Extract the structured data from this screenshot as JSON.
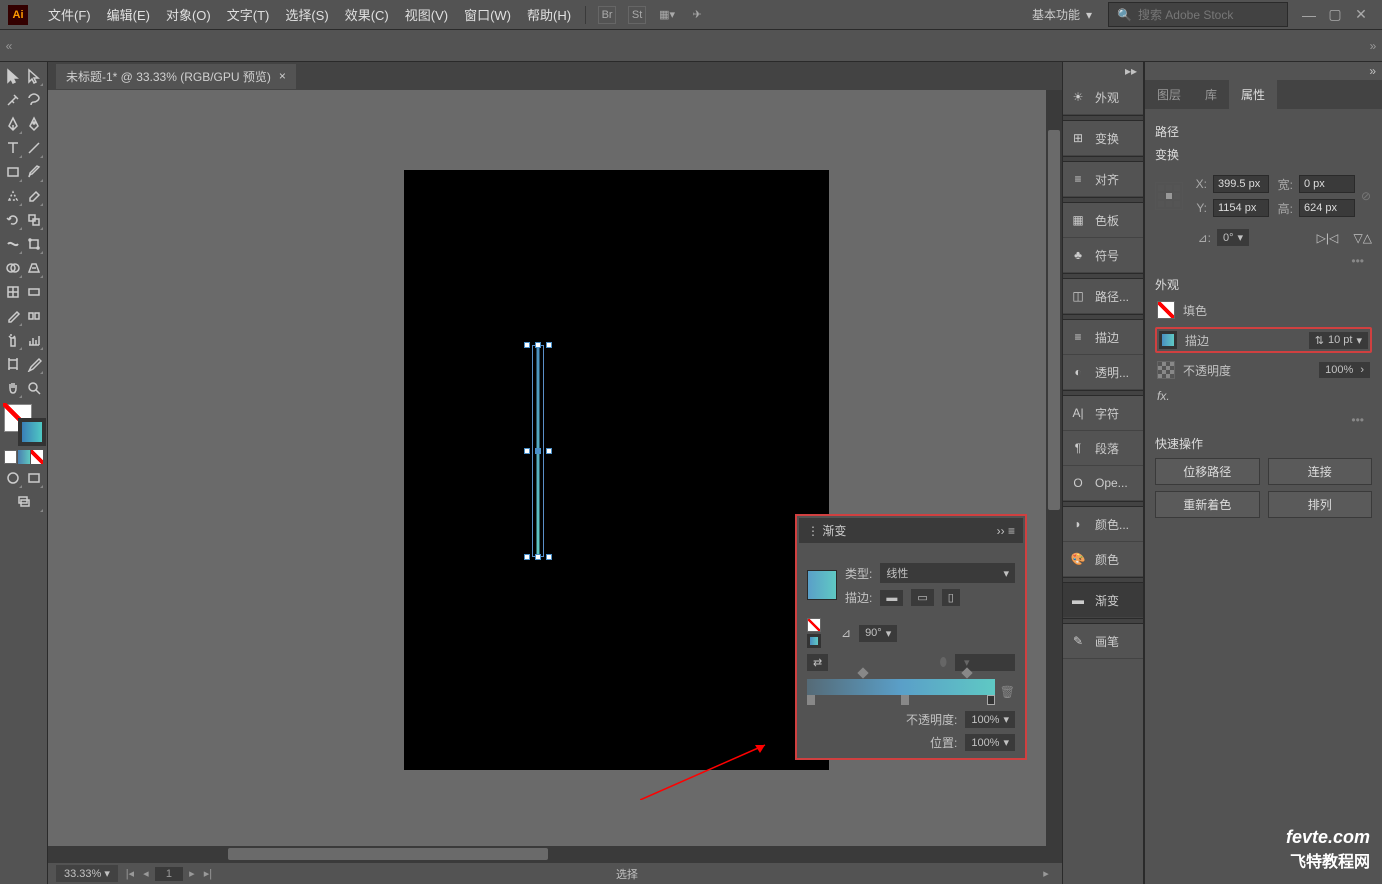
{
  "menubar": [
    "文件(F)",
    "编辑(E)",
    "对象(O)",
    "文字(T)",
    "选择(S)",
    "效果(C)",
    "视图(V)",
    "窗口(W)",
    "帮助(H)"
  ],
  "top_icons": [
    "Br",
    "St"
  ],
  "workspace": "基本功能",
  "search_placeholder": "搜索 Adobe Stock",
  "doc_tab": "未标题-1* @ 33.33% (RGB/GPU 预览)",
  "status": {
    "zoom": "33.33%",
    "mode": "选择"
  },
  "dock": [
    "外观",
    "变换",
    "对齐",
    "色板",
    "符号",
    "路径...",
    "描边",
    "透明...",
    "字符",
    "段落",
    "Ope...",
    "颜色...",
    "颜色",
    "渐变",
    "画笔"
  ],
  "dock_active": 13,
  "right_tabs": [
    "图层",
    "库",
    "属性"
  ],
  "right_tab_active": 2,
  "properties": {
    "header": "路径",
    "transform_label": "变换",
    "x_lbl": "X:",
    "x": "399.5 px",
    "w_lbl": "宽:",
    "w": "0 px",
    "y_lbl": "Y:",
    "y": "1154 px",
    "h_lbl": "高:",
    "h": "624 px",
    "rot_lbl": "⊿:",
    "rot": "0°",
    "appearance_label": "外观",
    "fill_label": "填色",
    "stroke_label": "描边",
    "stroke_val": "10 pt",
    "opacity_label": "不透明度",
    "opacity_val": "100%",
    "fx": "fx.",
    "quick_label": "快速操作",
    "qa": [
      "位移路径",
      "连接",
      "重新着色",
      "排列"
    ]
  },
  "gradient": {
    "title": "渐变",
    "type_lbl": "类型:",
    "type_val": "线性",
    "stroke_lbl": "描边:",
    "angle_lbl": "⊿",
    "angle": "90°",
    "opacity_lbl": "不透明度:",
    "opacity": "100%",
    "pos_lbl": "位置:",
    "pos": "100%"
  },
  "watermark": {
    "en": "fevte.com",
    "cn": "飞特教程网"
  }
}
